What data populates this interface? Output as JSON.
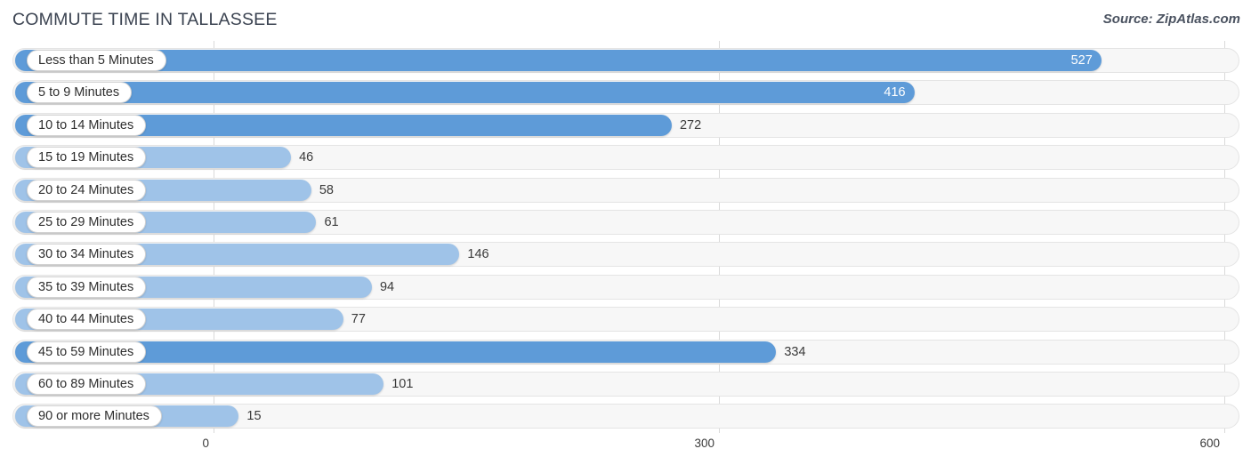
{
  "header": {
    "title": "COMMUTE TIME IN TALLASSEE",
    "source": "Source: ZipAtlas.com"
  },
  "colors": {
    "bar_dark": "#5e9bd8",
    "bar_light": "#9fc3e8",
    "track_fill": "#f7f7f7",
    "track_border": "#e4e4e4",
    "gridline": "#d9d9d9",
    "title_text": "#3b4351",
    "value_text_outside": "#3a3a3a",
    "value_text_inside": "#ffffff"
  },
  "chart_data": {
    "type": "bar",
    "orientation": "horizontal",
    "title": "COMMUTE TIME IN TALLASSEE",
    "xlabel": "",
    "ylabel": "",
    "xlim": [
      0,
      600
    ],
    "ticks": [
      "0",
      "300",
      "600"
    ],
    "tick_values": [
      0,
      300,
      600
    ],
    "grid": true,
    "legend": false,
    "categories": [
      "Less than 5 Minutes",
      "5 to 9 Minutes",
      "10 to 14 Minutes",
      "15 to 19 Minutes",
      "20 to 24 Minutes",
      "25 to 29 Minutes",
      "30 to 34 Minutes",
      "35 to 39 Minutes",
      "40 to 44 Minutes",
      "45 to 59 Minutes",
      "60 to 89 Minutes",
      "90 or more Minutes"
    ],
    "values": [
      527,
      416,
      272,
      46,
      58,
      61,
      146,
      94,
      77,
      334,
      101,
      15
    ],
    "value_labels": [
      "527",
      "416",
      "272",
      "46",
      "58",
      "61",
      "146",
      "94",
      "77",
      "334",
      "101",
      "15"
    ],
    "bars": [
      {
        "label": "Less than 5 Minutes",
        "value": 527,
        "value_label": "527",
        "shade": "dark",
        "label_position": "inside"
      },
      {
        "label": "5 to 9 Minutes",
        "value": 416,
        "value_label": "416",
        "shade": "dark",
        "label_position": "inside"
      },
      {
        "label": "10 to 14 Minutes",
        "value": 272,
        "value_label": "272",
        "shade": "dark",
        "label_position": "outside"
      },
      {
        "label": "15 to 19 Minutes",
        "value": 46,
        "value_label": "46",
        "shade": "light",
        "label_position": "outside"
      },
      {
        "label": "20 to 24 Minutes",
        "value": 58,
        "value_label": "58",
        "shade": "light",
        "label_position": "outside"
      },
      {
        "label": "25 to 29 Minutes",
        "value": 61,
        "value_label": "61",
        "shade": "light",
        "label_position": "outside"
      },
      {
        "label": "30 to 34 Minutes",
        "value": 146,
        "value_label": "146",
        "shade": "light",
        "label_position": "outside"
      },
      {
        "label": "35 to 39 Minutes",
        "value": 94,
        "value_label": "94",
        "shade": "light",
        "label_position": "outside"
      },
      {
        "label": "40 to 44 Minutes",
        "value": 77,
        "value_label": "77",
        "shade": "light",
        "label_position": "outside"
      },
      {
        "label": "45 to 59 Minutes",
        "value": 334,
        "value_label": "334",
        "shade": "dark",
        "label_position": "outside"
      },
      {
        "label": "60 to 89 Minutes",
        "value": 101,
        "value_label": "101",
        "shade": "light",
        "label_position": "outside"
      },
      {
        "label": "90 or more Minutes",
        "value": 15,
        "value_label": "15",
        "shade": "light",
        "label_position": "outside"
      }
    ]
  }
}
